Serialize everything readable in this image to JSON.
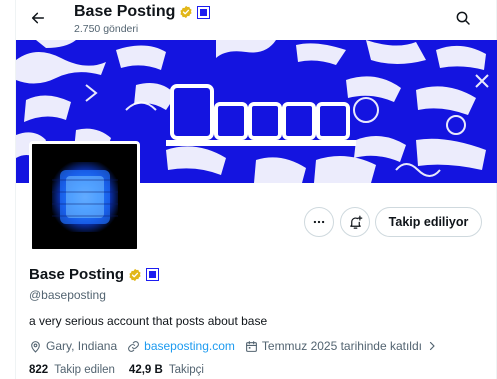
{
  "header": {
    "title": "Base Posting",
    "post_count": "2.750 gönderi"
  },
  "profile": {
    "display_name": "Base Posting",
    "handle": "@baseposting",
    "bio": "a very serious account that posts about base",
    "location": "Gary, Indiana",
    "website": "baseposting.com",
    "joined": "Temmuz 2025 tarihinde katıldı",
    "following_count": "822",
    "following_label": "Takip edilen",
    "followers_count": "42,9 B",
    "followers_label": "Takipçi"
  },
  "actions": {
    "follow_label": "Takip ediliyor"
  },
  "icons": {
    "back": "arrow-left-icon",
    "search": "search-icon",
    "verified": "verified-badge-icon",
    "affiliate": "affiliate-badge-icon",
    "more": "more-icon",
    "notify": "bell-plus-icon",
    "location": "location-pin-icon",
    "link": "link-icon",
    "calendar": "calendar-icon"
  },
  "colors": {
    "banner_blue": "#1414e0",
    "verified_gold": "#e2b719",
    "link_blue": "#1d9bf0",
    "muted": "#536471"
  }
}
